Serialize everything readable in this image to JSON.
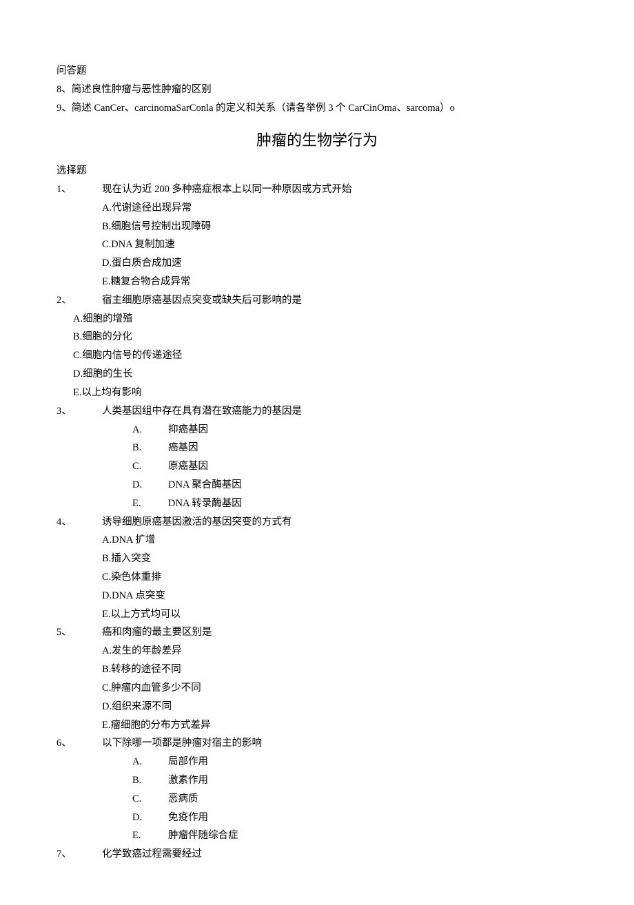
{
  "section1": {
    "label": "问答题",
    "items": [
      {
        "num": "8、",
        "text": "简述良性肿瘤与恶性肿瘤的区别"
      },
      {
        "num": "9、",
        "text": "简述 CanCer、carcinomaSarConla 的定义和关系（请各举例 3 个 CarCinOma、sarcoma）o"
      }
    ]
  },
  "title": "肿瘤的生物学行为",
  "section2": {
    "label": "选择题",
    "questions": [
      {
        "num": "1、",
        "stem": "现在认为近 200 多种癌症根本上以同一种原因或方式开始",
        "opt_style": "letter-prefix",
        "opt_indent": "wide",
        "options": [
          "A.代谢途径出现异常",
          "B.细胞信号控制出现障碍",
          "C.DNA 复制加速",
          "D.蛋白质合成加速",
          "E.糖复合物合成异常"
        ]
      },
      {
        "num": "2、",
        "stem": "宿主细胞原癌基因点突变或缺失后可影响的是",
        "opt_style": "letter-prefix",
        "opt_indent": "narrow",
        "options": [
          "A.细胞的增殖",
          "B.细胞的分化",
          "C.细胞内信号的传递途径",
          "D.细胞的生长",
          "E.以上均有影响"
        ]
      },
      {
        "num": "3、",
        "stem": "人类基因组中存在具有潜在致癌能力的基因是",
        "opt_style": "letter-dot",
        "opt_indent": "letter-dot",
        "options": [
          {
            "letter": "A.",
            "text": "抑癌基因"
          },
          {
            "letter": "B.",
            "text": "癌基因"
          },
          {
            "letter": "C.",
            "text": "原癌基因"
          },
          {
            "letter": "D.",
            "text": "DNA 聚合酶基因"
          },
          {
            "letter": "E.",
            "text": "DNA 转录酶基因"
          }
        ]
      },
      {
        "num": "4、",
        "stem": "诱导细胞原癌基因激活的基因突变的方式有",
        "opt_style": "letter-prefix",
        "opt_indent": "wide",
        "options": [
          "A.DNA 扩增",
          "B.插入突变",
          "C.染色体重排",
          "D.DNA 点突变",
          "E.以上方式均可以"
        ]
      },
      {
        "num": "5、",
        "stem": "癌和肉瘤的最主要区别是",
        "opt_style": "letter-prefix",
        "opt_indent": "wide",
        "options": [
          "A.发生的年龄差异",
          "B.转移的途径不同",
          "C.肿瘤内血管多少不同",
          "D.组织来源不同",
          "E.瘤细胞的分布方式差异"
        ]
      },
      {
        "num": "6、",
        "stem": "以下除哪一项都是肿瘤对宿主的影响",
        "opt_style": "letter-dot",
        "opt_indent": "letter-dot",
        "options": [
          {
            "letter": "A.",
            "text": "局部作用"
          },
          {
            "letter": "B.",
            "text": "激素作用"
          },
          {
            "letter": "C.",
            "text": "恶病质"
          },
          {
            "letter": "D.",
            "text": "免疫作用"
          },
          {
            "letter": "E.",
            "text": "肿瘤伴随综合症"
          }
        ]
      },
      {
        "num": "7、",
        "stem": "化学致癌过程需要经过",
        "opt_style": "letter-prefix",
        "opt_indent": "wide",
        "options": []
      }
    ]
  }
}
